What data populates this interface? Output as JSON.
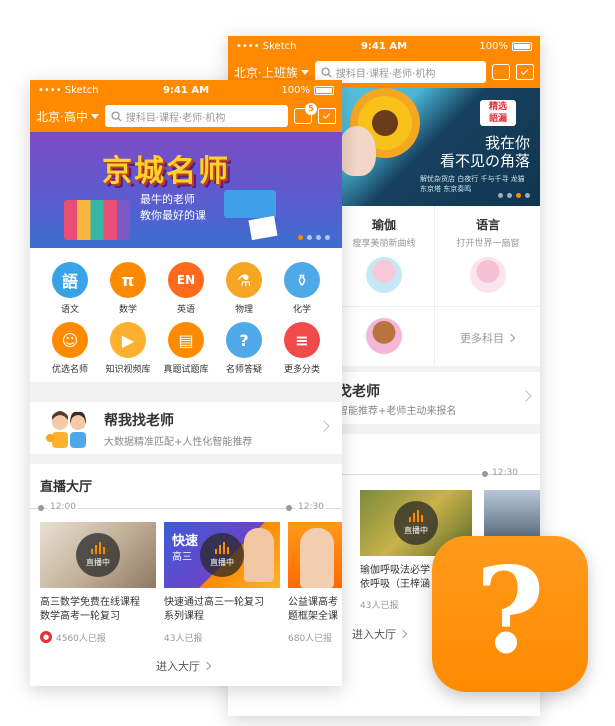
{
  "colors": {
    "accent": "#ff8a00",
    "live_dark": "#2b2b2b",
    "red": "#e6303c"
  },
  "back_phone": {
    "status": {
      "carrier": "•••• Sketch",
      "time": "9:41 AM",
      "battery": "100%"
    },
    "nav": {
      "city": "北京·上班族",
      "search_placeholder": "搜科目·课程·老师·机构"
    },
    "banner": {
      "seal": "精选\n語漏",
      "headline": "我在你\n看不见の角落",
      "tags": "解忧杂货店 白夜行 千与千寻 龙猫 东京塔 东京奏鸣"
    },
    "categories": [
      {
        "title": "瑜伽",
        "subtitle": "瘦享美丽新曲线"
      },
      {
        "title": "语言",
        "subtitle": "打开世界一扇窗"
      }
    ],
    "more_subjects": "更多科目",
    "find_teacher": {
      "title": "戈老师",
      "subtitle": "智能推荐+老师主动来报名"
    },
    "live": {
      "time": "12:30",
      "cards": [
        {
          "title": "瑜伽呼吸法必学",
          "title2": "依呼吸（王梓涵",
          "count": "43人已报"
        }
      ],
      "badge": "直播中",
      "enter": "进入大厅"
    }
  },
  "front_phone": {
    "status": {
      "carrier": "•••• Sketch",
      "time": "9:41 AM",
      "battery": "100%"
    },
    "nav": {
      "city": "北京·高中",
      "search_placeholder": "搜科目·课程·老师·机构",
      "message_count": "5"
    },
    "banner": {
      "headline": "京城名师",
      "line1": "最牛的老师",
      "line2": "教你最好的课"
    },
    "subjects": [
      {
        "icon": "語",
        "label": "语文",
        "color": "#3aa3e8"
      },
      {
        "icon": "π",
        "label": "数学",
        "color": "#ff8a00"
      },
      {
        "icon": "EN",
        "label": "英语",
        "color": "#ff6a1a"
      },
      {
        "icon": "⚗",
        "label": "物理",
        "color": "#f6a623"
      },
      {
        "icon": "⚱",
        "label": "化学",
        "color": "#4fa8e8"
      },
      {
        "icon": "☺",
        "label": "优选名师",
        "color": "#ff8a00"
      },
      {
        "icon": "▶",
        "label": "知识视频库",
        "color": "#ffb02e"
      },
      {
        "icon": "▤",
        "label": "真题试题库",
        "color": "#ff8a00"
      },
      {
        "icon": "?",
        "label": "名师答疑",
        "color": "#4fa8e8"
      },
      {
        "icon": "≡",
        "label": "更多分类",
        "color": "#f04a4a"
      }
    ],
    "find_teacher": {
      "title": "帮我找老师",
      "subtitle": "大数据精准匹配+人性化智能推荐"
    },
    "live": {
      "section_title": "直播大厅",
      "time_start": "12:00",
      "time_end": "12:30",
      "badge": "直播中",
      "cards": [
        {
          "title": "高三数学免费在线课程",
          "title2": "数学高考一轮复习",
          "count": "4560人已报"
        },
        {
          "title": "快速通过高三一轮复习",
          "title2": "系列课程",
          "count": "43人已报",
          "thumb_title": "快速",
          "thumb_sub": "高三"
        },
        {
          "title": "公益课高考",
          "title2": "题框架全课",
          "count": "680人已报"
        }
      ],
      "enter": "进入大厅"
    }
  },
  "app_icon": {
    "glyph": "?"
  }
}
